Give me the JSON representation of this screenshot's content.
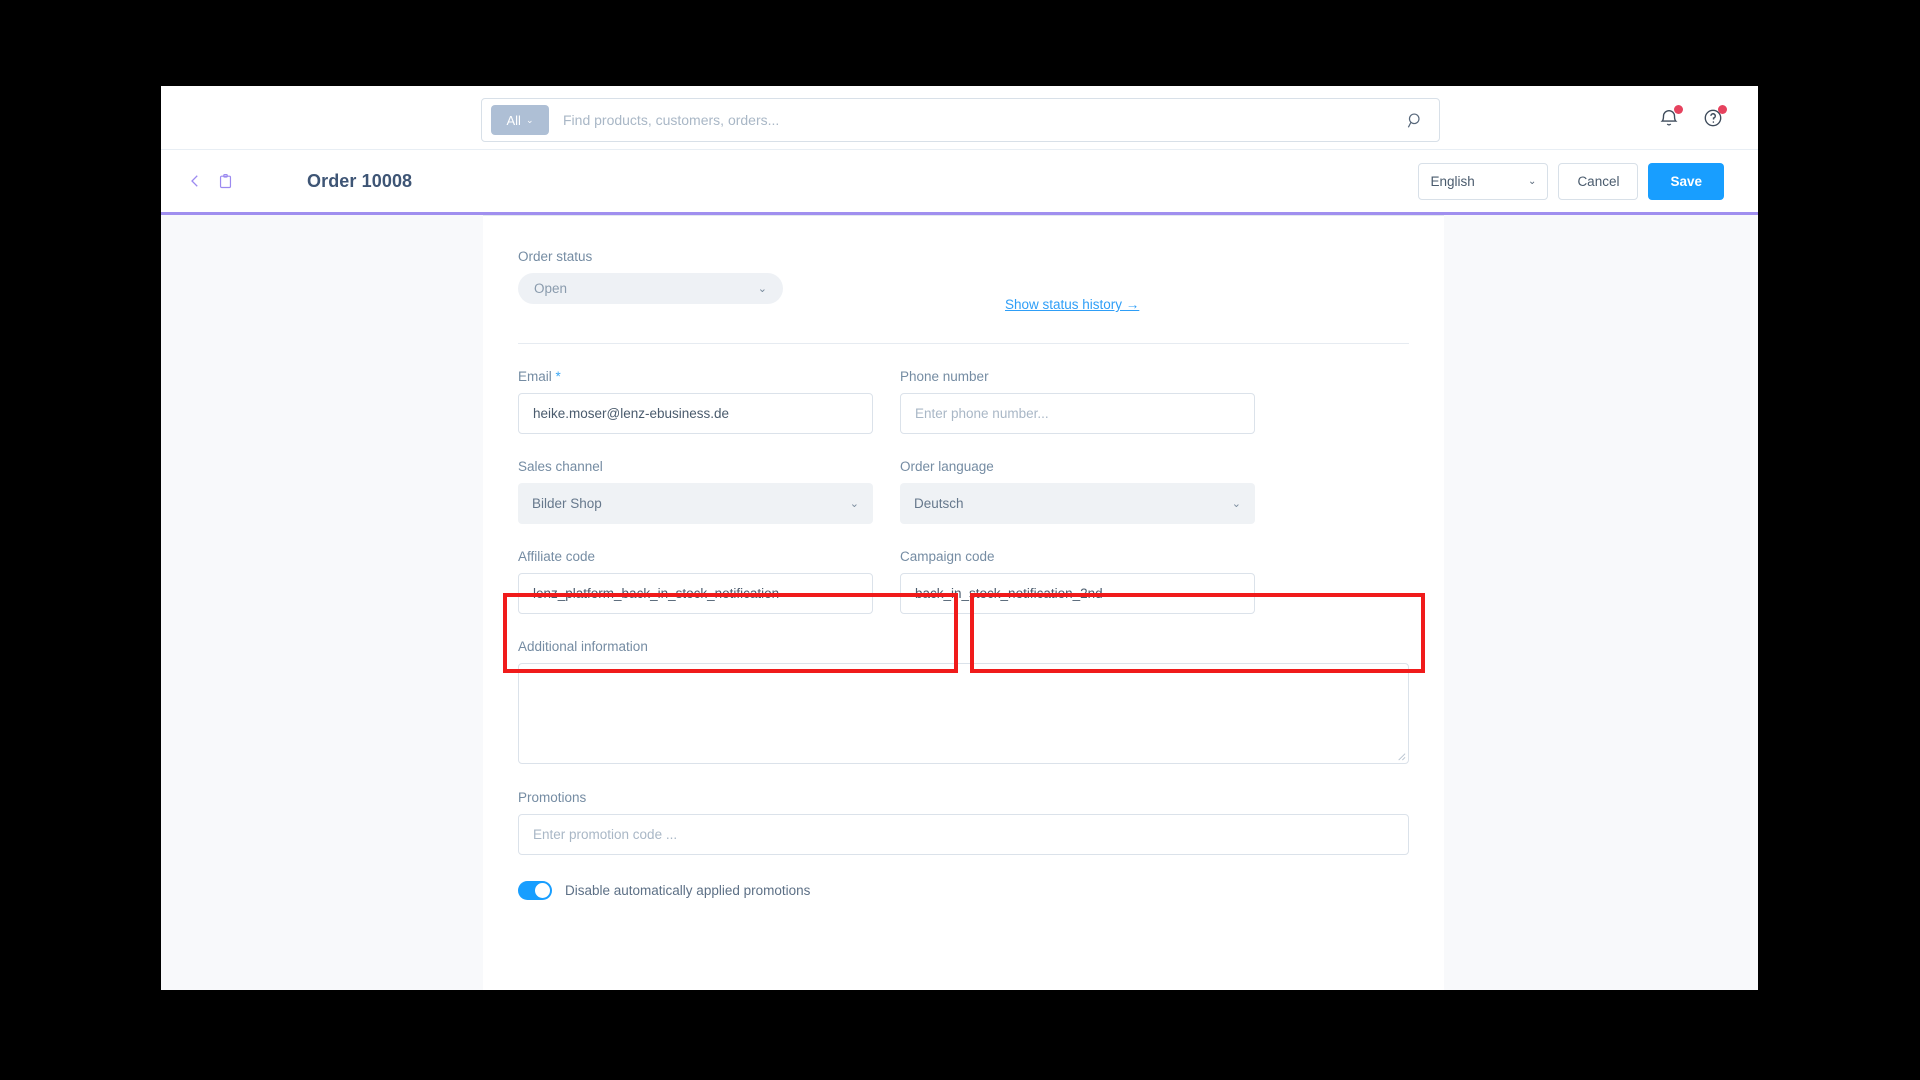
{
  "window": {
    "title": "Order 10008"
  },
  "topbar": {
    "scope": {
      "label": "All",
      "chevron": "⌄",
      "icon_name": "chevron-down-icon"
    },
    "search": {
      "placeholder": "Find products, customers, orders...",
      "value": "",
      "icon_name": "search-icon"
    },
    "icons": [
      {
        "name": "notification-bell-icon",
        "badge": true
      },
      {
        "name": "help-question-icon",
        "badge": true
      }
    ]
  },
  "header": {
    "back_icon": "chevron-left-icon",
    "doc_icon": "clipboard-icon",
    "title": "Order 10008",
    "language": {
      "value": "English",
      "chevron": "⌄"
    },
    "cancel_label": "Cancel",
    "save_label": "Save",
    "accent_color": "#a08fef",
    "save_color": "#189eff"
  },
  "form": {
    "order_status": {
      "label": "Order status",
      "value": "Open",
      "chevron": "⌄",
      "disabled": true
    },
    "status_history_link": "Show status history →",
    "email": {
      "label": "Email",
      "required_marker": "*",
      "value": "heike.moser@lenz-ebusiness.de",
      "placeholder": ""
    },
    "phone": {
      "label": "Phone number",
      "value": "",
      "placeholder": "Enter phone number..."
    },
    "sales_channel": {
      "label": "Sales channel",
      "value": "Bilder Shop",
      "chevron": "⌄",
      "disabled": true
    },
    "order_language": {
      "label": "Order language",
      "value": "Deutsch",
      "chevron": "⌄",
      "disabled": true
    },
    "affiliate_code": {
      "label": "Affiliate code",
      "value": "lenz_platform_back_in_stock_notification",
      "placeholder": ""
    },
    "campaign_code": {
      "label": "Campaign code",
      "value": "back_in_stock_notification_2nd",
      "placeholder": ""
    },
    "additional_information": {
      "label": "Additional information",
      "value": "",
      "placeholder": ""
    },
    "promotions": {
      "label": "Promotions",
      "value": "",
      "placeholder": "Enter promotion code ..."
    },
    "disable_promotions_toggle": {
      "label": "Disable automatically applied promotions",
      "state": "on"
    }
  },
  "annotations": {
    "color": "#f01b1b",
    "boxes": [
      {
        "name": "affiliate-code-highlight",
        "target": "Affiliate code"
      },
      {
        "name": "campaign-code-highlight",
        "target": "Campaign code"
      }
    ]
  }
}
